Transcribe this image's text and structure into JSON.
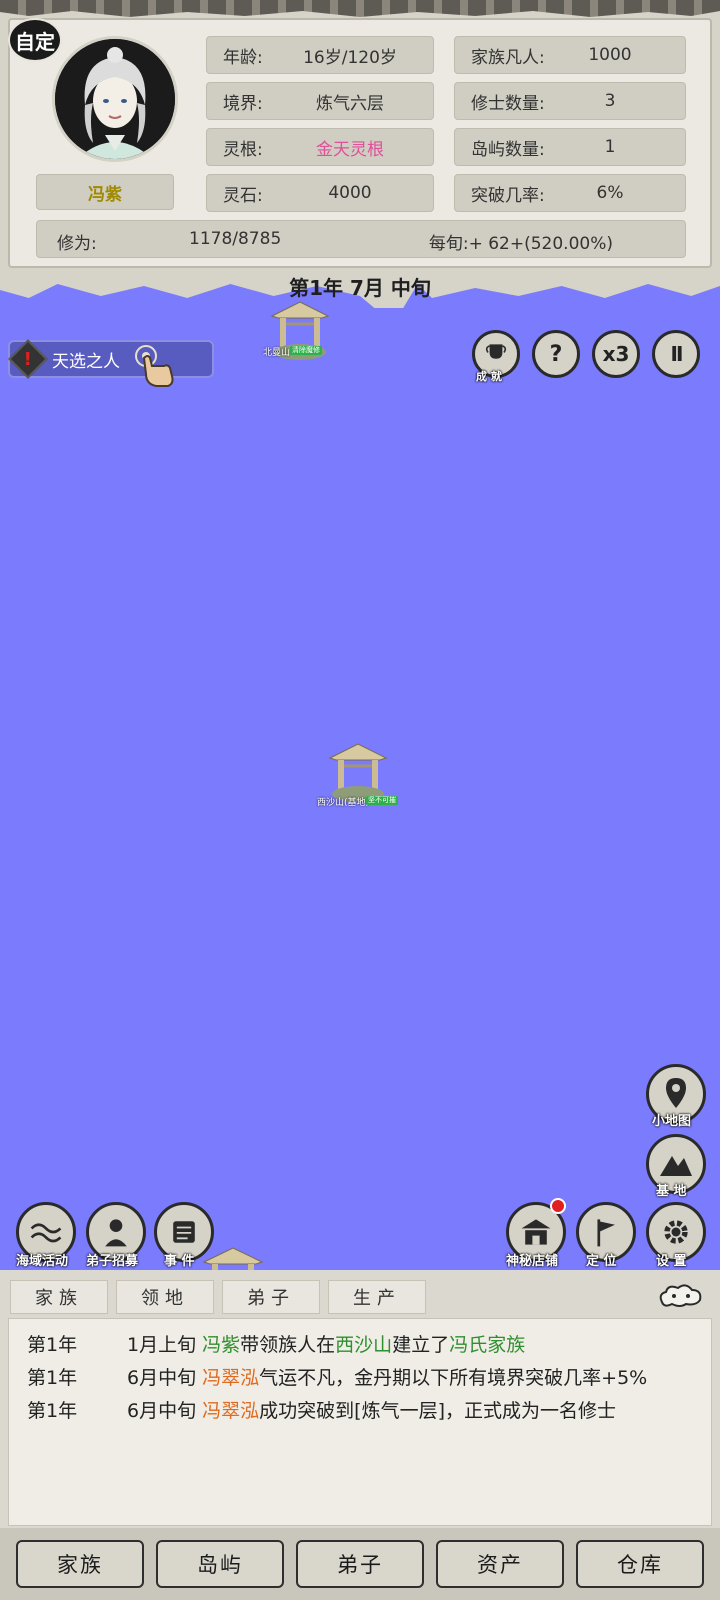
{
  "profile": {
    "custom_badge": "自定",
    "name": "冯紫",
    "age_label": "年龄:",
    "age_value": "16岁/120岁",
    "realm_label": "境界:",
    "realm_value": "炼气六层",
    "root_label": "灵根:",
    "root_value": "金天灵根",
    "stone_label": "灵石:",
    "stone_value": "4000",
    "commoners_label": "家族凡人:",
    "commoners_value": "1000",
    "cultivators_label": "修士数量:",
    "cultivators_value": "3",
    "islands_label": "岛屿数量:",
    "islands_value": "1",
    "breakthrough_label": "突破几率:",
    "breakthrough_value": "6%",
    "cultivation_label": "修为:",
    "cultivation_value": "1178/8785",
    "per_period": "每旬:+ 62+(520.00%)"
  },
  "date": "第1年 7月 中旬",
  "map": {
    "quest_label": "天选之人",
    "gate_top_name": "北曼山",
    "gate_top_tag": "清除魔修",
    "gate_center_name": "西沙山(基地)",
    "gate_center_tag": "坚不可摧"
  },
  "top_buttons": {
    "achievement": "成 就",
    "help": "?",
    "speed": "x3",
    "pause": "II"
  },
  "side_buttons": {
    "minimap": "小地图",
    "base": "基 地"
  },
  "action_buttons": {
    "sea_event": "海域活动",
    "recruit": "弟子招募",
    "events": "事 件",
    "shop": "神秘店铺",
    "locate": "定 位",
    "settings": "设 置"
  },
  "tabs": [
    "家族",
    "领地",
    "弟子",
    "生产"
  ],
  "log": [
    {
      "year": "第1年",
      "period": "1月上旬",
      "who": "冯紫",
      "t1": "带领族人在",
      "place": "西沙山",
      "t2": "建立了",
      "clan": "冯氏家族"
    },
    {
      "year": "第1年",
      "period": "6月中旬",
      "who": "冯翠泓",
      "text": "气运不凡，金丹期以下所有境界突破几率+5%"
    },
    {
      "year": "第1年",
      "period": "6月中旬",
      "who": "冯翠泓",
      "text": "成功突破到[炼气一层]，正式成为一名修士"
    }
  ],
  "nav": [
    "家族",
    "岛屿",
    "弟子",
    "资产",
    "仓库"
  ],
  "colors": {
    "sea": "#7b7bfd",
    "name_gold": "#a08a00",
    "root_pink": "#e0509a",
    "log_green": "#2f8f2f",
    "log_orange": "#e06a20"
  }
}
